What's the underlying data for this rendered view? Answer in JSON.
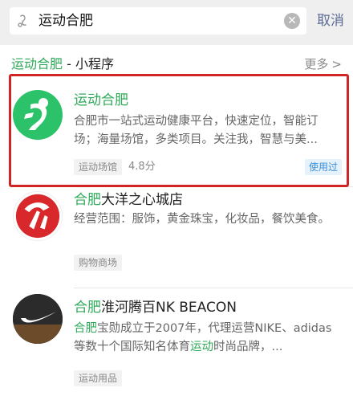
{
  "search": {
    "query": "运动合肥",
    "cancel_label": "取消"
  },
  "section": {
    "keyword": "运动合肥",
    "suffix": " - 小程序",
    "more_label": "更多"
  },
  "results": [
    {
      "title_hl": "运动合肥",
      "title_rest": "",
      "desc": "合肥市一站式运动健康平台，快速定位，智能订场；海量场馆，多类项目。关注我，智慧与美...",
      "tag": "运动场馆",
      "rating": "4.8分",
      "badge": "使用过"
    },
    {
      "title_hl": "合肥",
      "title_rest": "大洋之心城店",
      "desc": "经营范围：服饰，黄金珠宝，化妆品，餐饮美食。",
      "tag": "购物商场"
    },
    {
      "title_hl": "合肥",
      "title_rest": "淮河腾百NK BEACON",
      "desc_hl1": "合肥",
      "desc_mid": "宝勋成立于2007年，代理运营NIKE、adidas等数十个国际知名体育",
      "desc_hl2": "运动",
      "desc_end": "时尚品牌，...",
      "tag": "运动用品"
    }
  ],
  "colors": {
    "highlight": "#2faa5a",
    "frame": "#d02524",
    "link": "#5b6b95"
  },
  "icons": [
    "search-icon",
    "clear-icon",
    "chevron-right-icon",
    "runner-logo-icon",
    "wanda-logo-icon",
    "nike-logo-icon"
  ]
}
